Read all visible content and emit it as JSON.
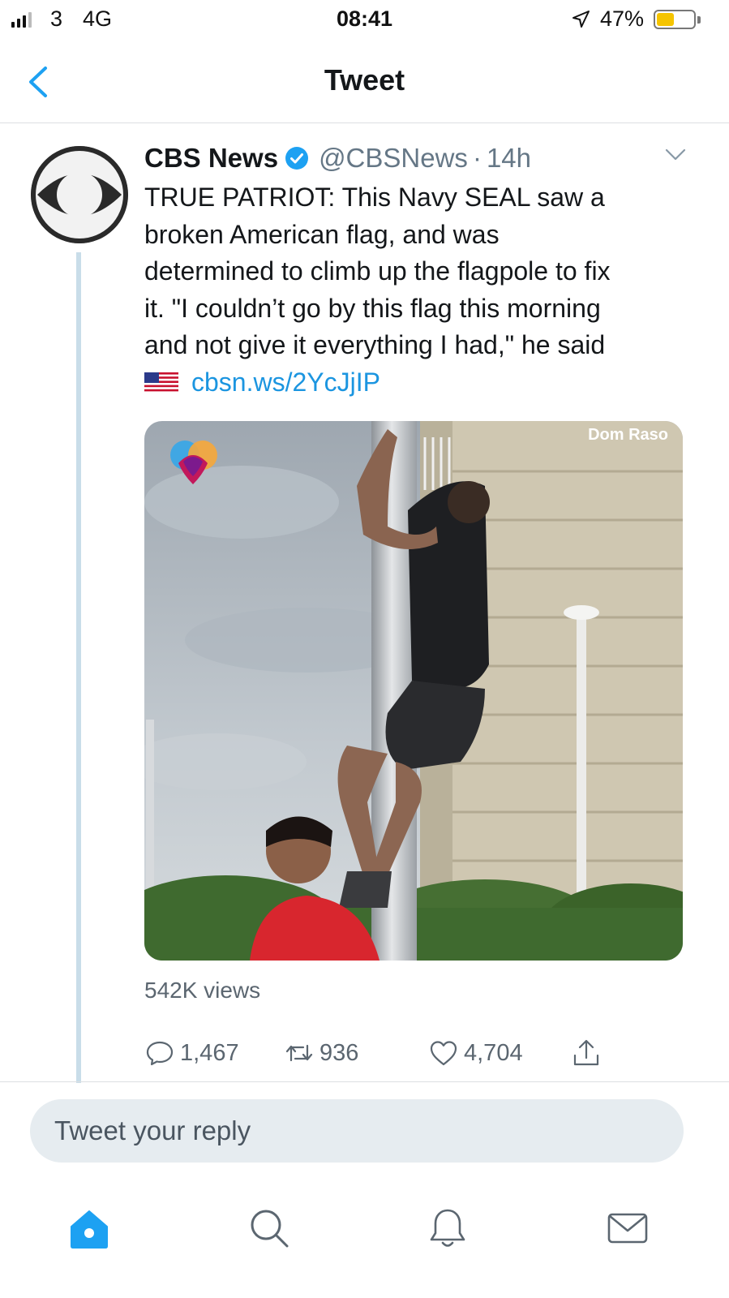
{
  "status_bar": {
    "carrier": "3",
    "network": "4G",
    "time": "08:41",
    "battery_percent": "47%",
    "battery_level": 0.47,
    "battery_color": "#f5c400",
    "icons": [
      "signal-icon",
      "location-arrow-icon",
      "battery-icon"
    ]
  },
  "nav": {
    "title": "Tweet",
    "back_icon": "chevron-left-icon",
    "accent_color": "#1da1f2"
  },
  "tweet": {
    "author_name": "CBS News",
    "verified": true,
    "handle": "@CBSNews",
    "separator": "·",
    "age": "14h",
    "text_lines": [
      "TRUE PATRIOT: This Navy SEAL saw a",
      "broken American flag, and was",
      "determined to climb up the flagpole to fix",
      "it. \"I couldn’t go by this flag this morning",
      "and not give it everything I had,\" he said"
    ],
    "flag_emoji_icon": "us-flag-icon",
    "link": "cbsn.ws/2YcJjIP",
    "media_watermark": "Dom Raso",
    "views": "542K views",
    "actions": {
      "replies": "1,467",
      "retweets": "936",
      "likes": "4,704"
    }
  },
  "reply_box": {
    "placeholder": "Tweet your reply"
  },
  "tabbar": {
    "items": [
      "home-icon",
      "search-icon",
      "notifications-icon",
      "messages-icon"
    ],
    "active": "home-icon"
  }
}
